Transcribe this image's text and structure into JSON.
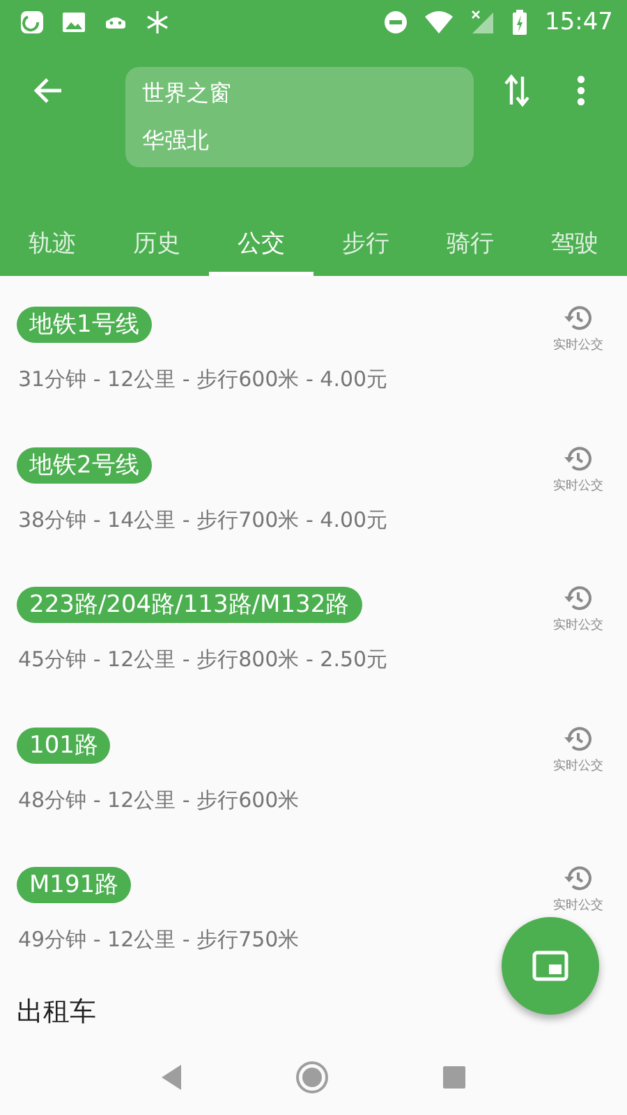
{
  "status_bar": {
    "time": "15:47"
  },
  "route": {
    "from": "世界之窗",
    "to": "华强北"
  },
  "tabs": [
    {
      "label": "轨迹",
      "selected": false
    },
    {
      "label": "历史",
      "selected": false
    },
    {
      "label": "公交",
      "selected": true
    },
    {
      "label": "步行",
      "selected": false
    },
    {
      "label": "骑行",
      "selected": false
    },
    {
      "label": "驾驶",
      "selected": false
    }
  ],
  "routes": [
    {
      "line": "地铁1号线",
      "summary": "31分钟 - 12公里 - 步行600米 - 4.00元",
      "realtime_label": "实时公交"
    },
    {
      "line": "地铁2号线",
      "summary": "38分钟 - 14公里 - 步行700米 - 4.00元",
      "realtime_label": "实时公交"
    },
    {
      "line": "223路/204路/113路/M132路",
      "summary": "45分钟 - 12公里 - 步行800米 - 2.50元",
      "realtime_label": "实时公交"
    },
    {
      "line": "101路",
      "summary": "48分钟 - 12公里 - 步行600米",
      "realtime_label": "实时公交"
    },
    {
      "line": "M191路",
      "summary": "49分钟 - 12公里 - 步行750米",
      "realtime_label": "实时公交"
    }
  ],
  "taxi": {
    "title": "出租车"
  }
}
